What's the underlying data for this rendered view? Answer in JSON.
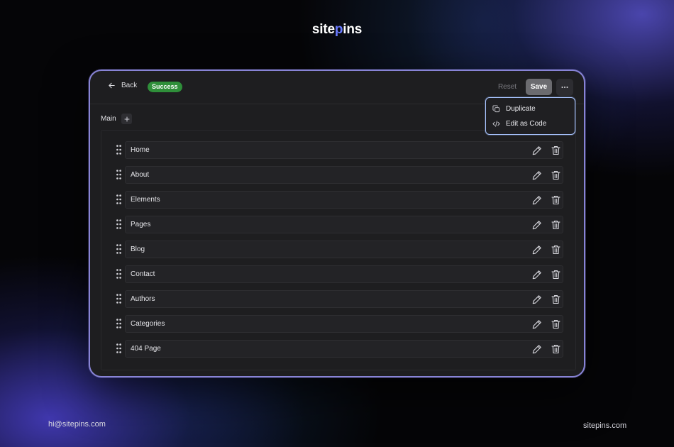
{
  "brand": {
    "logo_prefix": "site",
    "logo_accent": "p",
    "logo_suffix": "ins"
  },
  "header": {
    "back_label": "Back",
    "status_badge": "Success",
    "reset_label": "Reset",
    "save_label": "Save",
    "more_icon": "more-horizontal-icon"
  },
  "menu": {
    "items": [
      {
        "label": "Duplicate",
        "icon": "duplicate-icon"
      },
      {
        "label": "Edit as Code",
        "icon": "code-icon"
      }
    ]
  },
  "section": {
    "label": "Main",
    "add_icon": "plus-icon"
  },
  "list": {
    "items": [
      {
        "label": "Home"
      },
      {
        "label": "About"
      },
      {
        "label": "Elements"
      },
      {
        "label": "Pages"
      },
      {
        "label": "Blog"
      },
      {
        "label": "Contact"
      },
      {
        "label": "Authors"
      },
      {
        "label": "Categories"
      },
      {
        "label": "404 Page"
      }
    ],
    "row_icons": [
      "drag-handle-icon",
      "pencil-icon",
      "trash-icon"
    ]
  },
  "footer": {
    "email": "hi@sitepins.com",
    "website": "sitepins.com"
  },
  "colors": {
    "success": "#2f8f3a",
    "window_border": "#8884d6",
    "menu_border": "#a8c4ff",
    "logo_accent": "#6a7bff"
  }
}
